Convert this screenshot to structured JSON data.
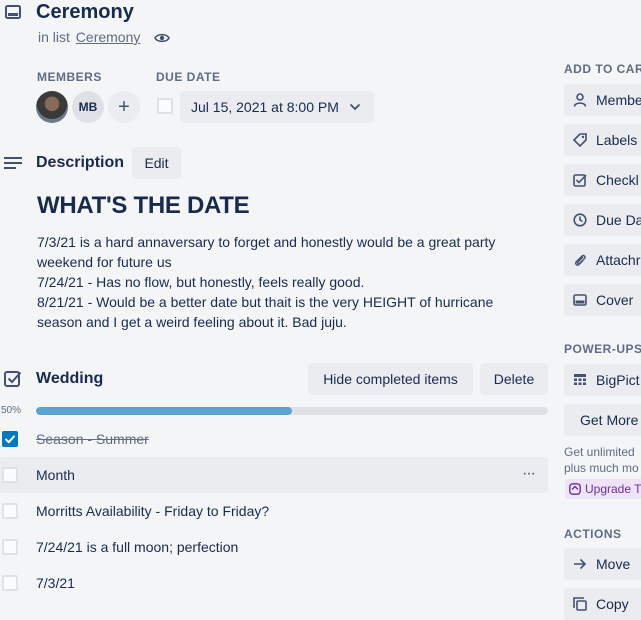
{
  "card": {
    "title": "Ceremony",
    "in_list_prefix": "in list",
    "list_name": "Ceremony"
  },
  "members": {
    "label": "MEMBERS",
    "initials": "MB",
    "add_symbol": "+"
  },
  "due_date": {
    "label": "DUE DATE",
    "value": "Jul 15, 2021 at 8:00 PM"
  },
  "description": {
    "heading": "Description",
    "edit_label": "Edit",
    "title": "WHAT'S THE DATE",
    "lines": [
      "7/3/21 is a hard annaversary to forget and honestly would be a great party",
      "weekend for future us",
      "7/24/21 - Has no flow, but honestly, feels really good.",
      "8/21/21 - Would be a better date but thait is the very HEIGHT of hurricane",
      "season and I get a weird feeling about it. Bad juju."
    ]
  },
  "checklist": {
    "title": "Wedding",
    "hide_label": "Hide completed items",
    "delete_label": "Delete",
    "progress_text": "50%",
    "progress": 0.5,
    "items": [
      {
        "text": "Season - Summer",
        "checked": true
      },
      {
        "text": "Month",
        "checked": false
      },
      {
        "text": "Morritts Availability - Friday to Friday?",
        "checked": false
      },
      {
        "text": "7/24/21 is a full moon; perfection",
        "checked": false
      },
      {
        "text": "7/3/21",
        "checked": false
      }
    ],
    "more_symbol": "···"
  },
  "sidebar": {
    "add_label": "ADD TO CAR",
    "add_items": [
      {
        "label": "Membe",
        "icon": "person-icon"
      },
      {
        "label": "Labels",
        "icon": "label-icon"
      },
      {
        "label": "Checkl",
        "icon": "checklist-icon"
      },
      {
        "label": "Due Da",
        "icon": "clock-icon"
      },
      {
        "label": "Attachr",
        "icon": "paperclip-icon"
      },
      {
        "label": "Cover",
        "icon": "cover-icon"
      }
    ],
    "powerups_label": "POWER-UPS",
    "bigpicture_label": "BigPict",
    "get_more_label": "Get More",
    "promo_line1": "Get unlimited",
    "promo_line2": "plus much mo",
    "upgrade_label": "Upgrade T",
    "actions_label": "ACTIONS",
    "move_label": "Move",
    "copy_label": "Copy"
  },
  "colors": {
    "accent": "#0079bf",
    "progress_fill": "#5ba4cf",
    "progress_track": "#dfe1e6",
    "upgrade_bg": "#efe3f8",
    "upgrade_text": "#6e2f99"
  }
}
